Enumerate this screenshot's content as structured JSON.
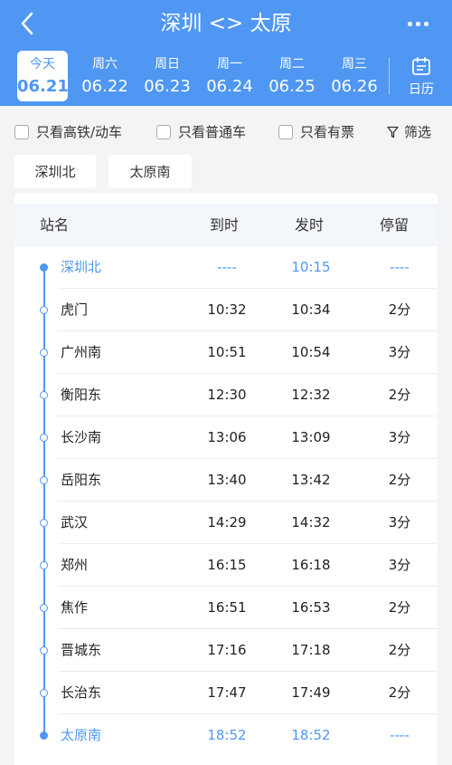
{
  "header": {
    "title": "深圳 <> 太原",
    "calendar_label": "日历"
  },
  "dates": [
    {
      "weekday": "今天",
      "date": "06.21",
      "active": true
    },
    {
      "weekday": "周六",
      "date": "06.22"
    },
    {
      "weekday": "周日",
      "date": "06.23"
    },
    {
      "weekday": "周一",
      "date": "06.24"
    },
    {
      "weekday": "周二",
      "date": "06.25"
    },
    {
      "weekday": "周三",
      "date": "06.26"
    }
  ],
  "filters": {
    "high_speed": "只看高铁/动车",
    "regular": "只看普通车",
    "available": "只看有票",
    "filter_button": "筛选"
  },
  "stations": {
    "from": "深圳北",
    "to": "太原南"
  },
  "table": {
    "headers": {
      "station": "站名",
      "arrive": "到时",
      "depart": "发时",
      "stop": "停留"
    },
    "rows": [
      {
        "name": "深圳北",
        "arrive": "----",
        "depart": "10:15",
        "stop": "----",
        "highlight": true
      },
      {
        "name": "虎门",
        "arrive": "10:32",
        "depart": "10:34",
        "stop": "2分"
      },
      {
        "name": "广州南",
        "arrive": "10:51",
        "depart": "10:54",
        "stop": "3分"
      },
      {
        "name": "衡阳东",
        "arrive": "12:30",
        "depart": "12:32",
        "stop": "2分"
      },
      {
        "name": "长沙南",
        "arrive": "13:06",
        "depart": "13:09",
        "stop": "3分"
      },
      {
        "name": "岳阳东",
        "arrive": "13:40",
        "depart": "13:42",
        "stop": "2分"
      },
      {
        "name": "武汉",
        "arrive": "14:29",
        "depart": "14:32",
        "stop": "3分"
      },
      {
        "name": "郑州",
        "arrive": "16:15",
        "depart": "16:18",
        "stop": "3分"
      },
      {
        "name": "焦作",
        "arrive": "16:51",
        "depart": "16:53",
        "stop": "2分"
      },
      {
        "name": "晋城东",
        "arrive": "17:16",
        "depart": "17:18",
        "stop": "2分"
      },
      {
        "name": "长治东",
        "arrive": "17:47",
        "depart": "17:49",
        "stop": "2分"
      },
      {
        "name": "太原南",
        "arrive": "18:52",
        "depart": "18:52",
        "stop": "----",
        "highlight": true
      }
    ]
  },
  "colors": {
    "accent": "#4f97f2",
    "background": "#f3f4f6"
  }
}
